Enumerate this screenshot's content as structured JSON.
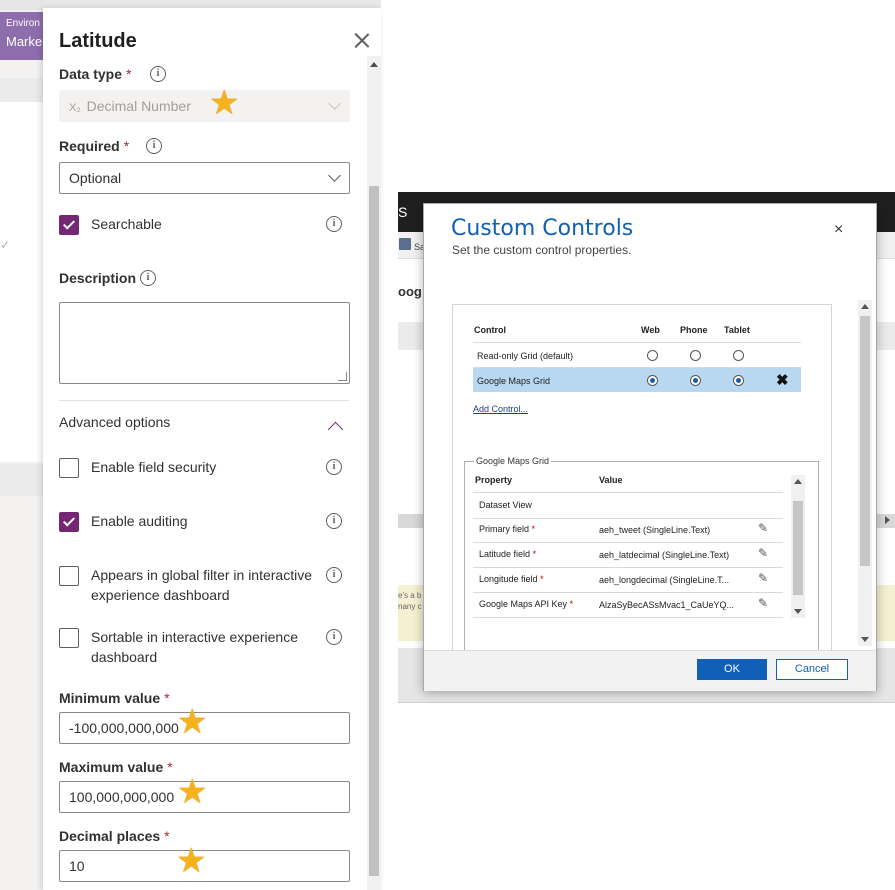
{
  "background": {
    "env_line1": "Environ",
    "env_line2": "Marke",
    "check_glyph": "✓"
  },
  "panel": {
    "title": "Latitude",
    "data_type": {
      "label": "Data type",
      "required_mark": "*",
      "subscript": "X₂",
      "value": "Decimal Number"
    },
    "required": {
      "label": "Required",
      "required_mark": "*",
      "value": "Optional"
    },
    "searchable": {
      "label": "Searchable",
      "checked": true
    },
    "description": {
      "label": "Description",
      "value": ""
    },
    "advanced_options": {
      "label": "Advanced options",
      "expanded": true
    },
    "enable_field_security": {
      "label": "Enable field security",
      "checked": false
    },
    "enable_auditing": {
      "label": "Enable auditing",
      "checked": true
    },
    "global_filter": {
      "label": "Appears in global filter in interactive experience dashboard",
      "checked": false
    },
    "sortable": {
      "label": "Sortable in interactive experience dashboard",
      "checked": false
    },
    "minimum_value": {
      "label": "Minimum value",
      "required_mark": "*",
      "value": "-100,000,000,000"
    },
    "maximum_value": {
      "label": "Maximum value",
      "required_mark": "*",
      "value": "100,000,000,000"
    },
    "decimal_places": {
      "label": "Decimal places",
      "required_mark": "*",
      "value": "10"
    },
    "info_glyph": "i",
    "star_glyph": "★"
  },
  "dynamics": {
    "toolbar_letter": "S",
    "save_text": "Sa",
    "heading_fragment": "oog",
    "notice_text": "e's a b\nnany c"
  },
  "dialog": {
    "title": "Custom Controls",
    "subtitle": "Set the custom control properties.",
    "close_glyph": "×",
    "controls_table": {
      "headers": {
        "control": "Control",
        "web": "Web",
        "phone": "Phone",
        "tablet": "Tablet"
      },
      "rows": [
        {
          "name": "Read-only Grid (default)",
          "web": false,
          "phone": false,
          "tablet": false,
          "selected": false
        },
        {
          "name": "Google Maps Grid",
          "web": true,
          "phone": true,
          "tablet": true,
          "selected": true
        }
      ],
      "delete_glyph": "✖",
      "add_control": "Add Control..."
    },
    "properties": {
      "legend": "Google Maps Grid",
      "headers": {
        "property": "Property",
        "value": "Value"
      },
      "rows": [
        {
          "property": "Dataset View",
          "required": false,
          "value": ""
        },
        {
          "property": "Primary field",
          "required": true,
          "value": "aeh_tweet (SingleLine.Text)"
        },
        {
          "property": "Latitude field",
          "required": true,
          "value": "aeh_latdecimal (SingleLine.Text)"
        },
        {
          "property": "Longitude field",
          "required": true,
          "value": "aeh_longdecimal (SingleLine.T..."
        },
        {
          "property": "Google Maps API Key",
          "required": true,
          "value": "AlzaSyBecASsMvac1_CaUeYQ..."
        }
      ],
      "required_mark": "*",
      "pencil_glyph": "✎"
    },
    "ok_label": "OK",
    "cancel_label": "Cancel"
  }
}
